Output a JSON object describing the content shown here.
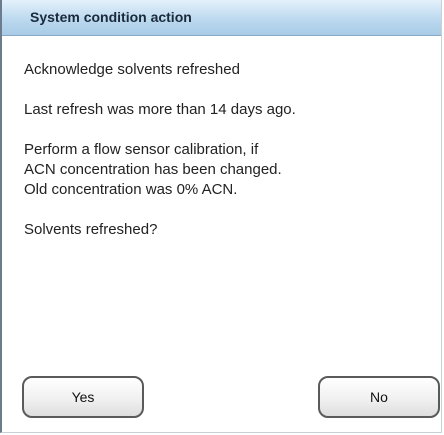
{
  "dialog": {
    "title": "System condition action",
    "lines": [
      "Acknowledge solvents refreshed",
      "Last refresh was more than 14 days ago.",
      "Perform a flow sensor calibration, if",
      "ACN concentration has been changed.",
      "Old concentration was 0% ACN.",
      "Solvents refreshed?"
    ],
    "yes_label": "Yes",
    "no_label": "No"
  }
}
